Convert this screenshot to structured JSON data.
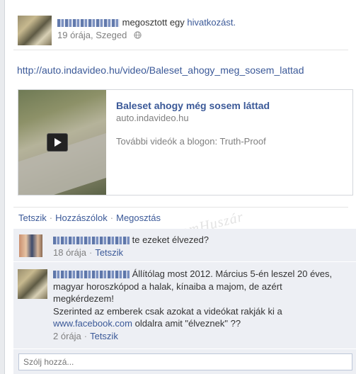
{
  "post": {
    "action_text": "megosztott egy",
    "action_link": "hivatkozást.",
    "time": "19 órája, Szeged",
    "url": "http://auto.indavideo.hu/video/Baleset_ahogy_meg_sosem_lattad",
    "preview": {
      "title": "Baleset ahogy még sosem láttad",
      "domain": "auto.indavideo.hu",
      "description": "További videók a blogon: Truth-Proof"
    },
    "actions": [
      "Tetszik",
      "Hozzászólok",
      "Megosztás"
    ]
  },
  "comments": [
    {
      "text": "te ezeket élvezed?",
      "time": "18 órája",
      "like": "Tetszik"
    },
    {
      "text_line1": "Állítólag most 2012. Március 5-én leszel 20 éves,",
      "text_line2": "magyar horoszkópod a halak, kínaiba a majom, de azért",
      "text_line3": "megkérdezem!",
      "text_line4": "Szerinted az emberek csak azokat a videókat rakják ki a",
      "link": "www.facebook.com",
      "text_line5": "oldalra amit \"élveznek\" ??",
      "time": "2 órája",
      "like": "Tetszik"
    }
  ],
  "reply": {
    "placeholder": "Szólj hozzá..."
  },
  "watermark": "PhantomHuszár",
  "icons": {
    "globe": "globe-icon",
    "play": "play-icon"
  },
  "colors": {
    "link": "#3b5998",
    "comment_bg": "#edeff4"
  }
}
